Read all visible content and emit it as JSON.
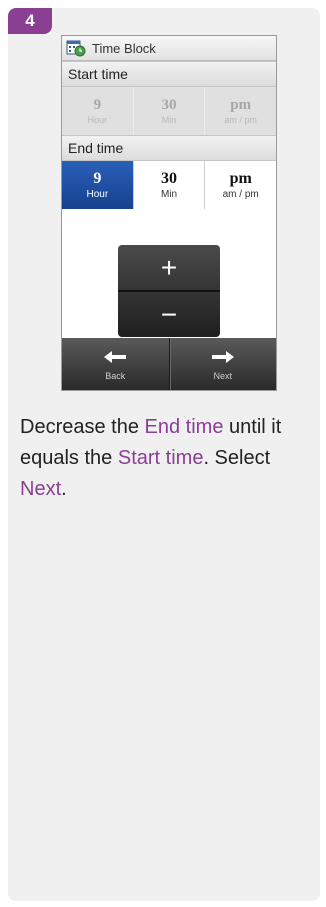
{
  "step": {
    "number": "4"
  },
  "device": {
    "title": "Time Block",
    "start_label": "Start time",
    "start": [
      {
        "value": "9",
        "unit": "Hour"
      },
      {
        "value": "30",
        "unit": "Min"
      },
      {
        "value": "pm",
        "unit": "am / pm"
      }
    ],
    "end_label": "End time",
    "end": [
      {
        "value": "9",
        "unit": "Hour",
        "selected": true
      },
      {
        "value": "30",
        "unit": "Min"
      },
      {
        "value": "pm",
        "unit": "am / pm"
      }
    ],
    "stepper": {
      "plus": "+",
      "minus": "−"
    },
    "nav": {
      "back_label": "Back",
      "back_arrow": "🡐",
      "next_label": "Next",
      "next_arrow": "🡒"
    }
  },
  "instruction": {
    "t1": "Decrease the ",
    "h1": "End time",
    "t2": " until it equals the ",
    "h2": "Start time",
    "t3": ". Select ",
    "h3": "Next",
    "t4": "."
  },
  "colors": {
    "accent": "#8b3f93",
    "selected": "#1e4fa3",
    "panel": "#f0f0f1"
  }
}
